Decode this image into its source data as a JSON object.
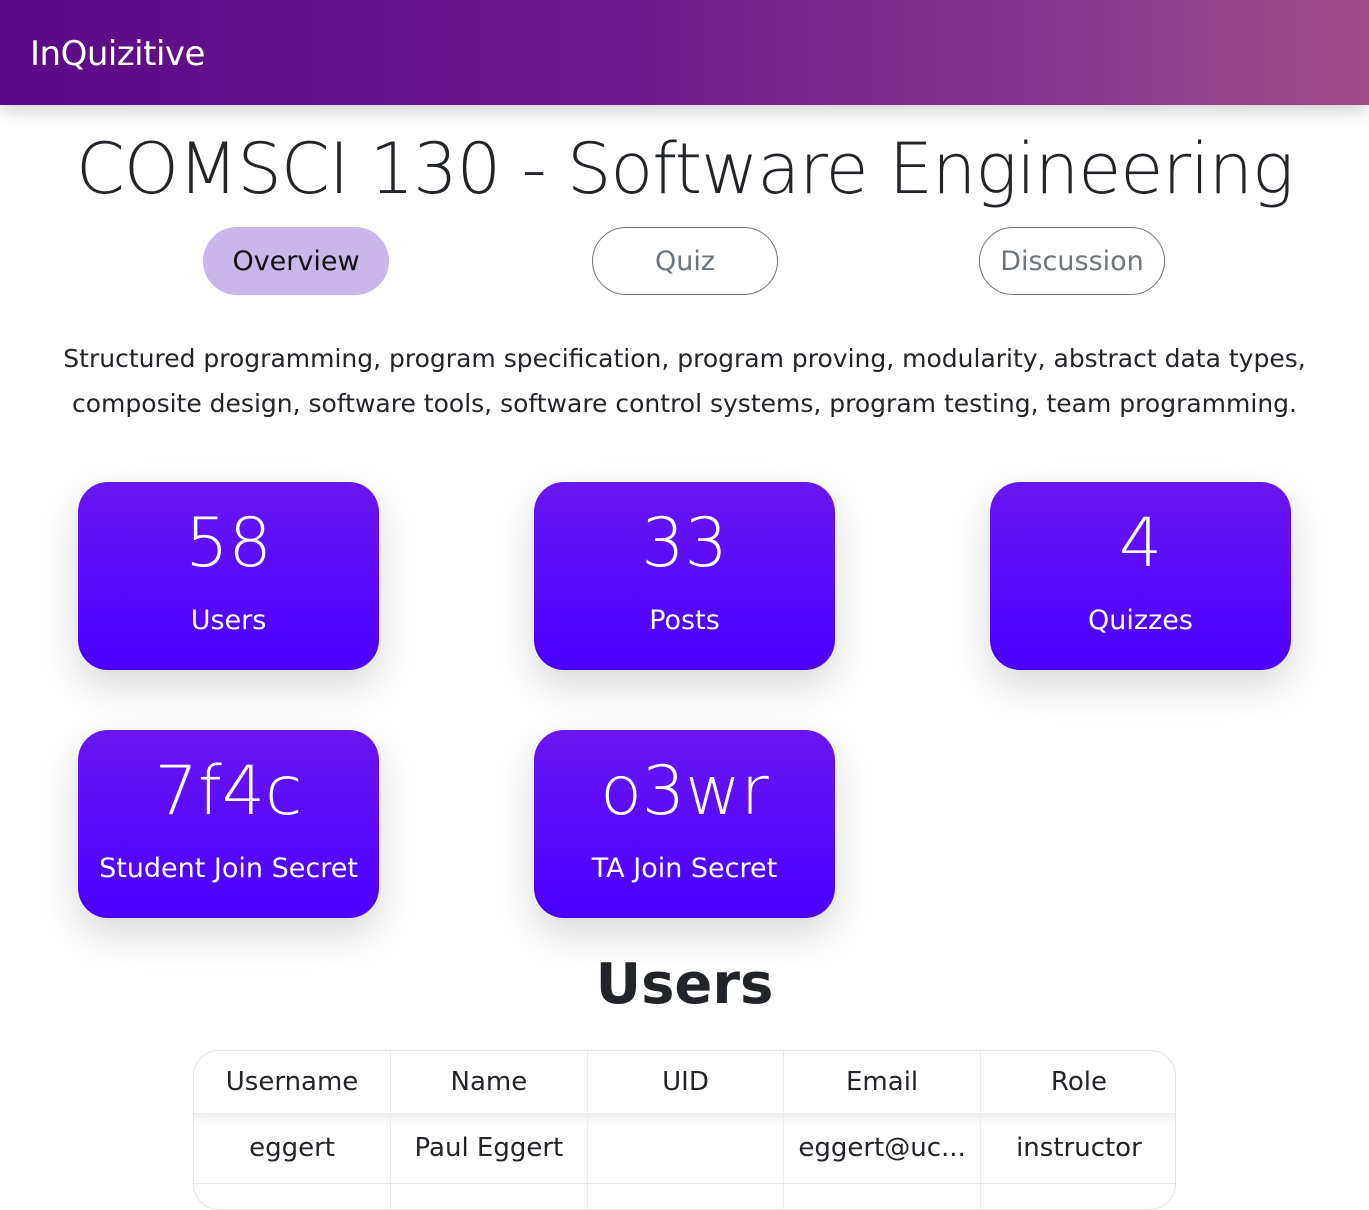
{
  "app": {
    "brand": "InQuizitive"
  },
  "course": {
    "title": "COMSCI 130 - Software Engineering",
    "description": "Structured programming, program specification, program proving, modularity, abstract data types, composite design, software tools, software control systems, program testing, team programming."
  },
  "tabs": [
    {
      "label": "Overview",
      "active": true
    },
    {
      "label": "Quiz",
      "active": false
    },
    {
      "label": "Discussion",
      "active": false
    }
  ],
  "stats": [
    {
      "value": "58",
      "label": "Users"
    },
    {
      "value": "33",
      "label": "Posts"
    },
    {
      "value": "4",
      "label": "Quizzes"
    },
    {
      "value": "7f4c",
      "label": "Student Join Secret"
    },
    {
      "value": "o3wr",
      "label": "TA Join Secret"
    }
  ],
  "users": {
    "heading": "Users",
    "columns": [
      "Username",
      "Name",
      "UID",
      "Email",
      "Role"
    ],
    "rows": [
      [
        "eggert",
        "Paul Eggert",
        "",
        "eggert@uc...",
        "instructor"
      ],
      [
        "",
        "",
        "",
        "",
        ""
      ]
    ]
  },
  "colors": {
    "navbar_start": "#5a0b86",
    "navbar_end": "#a24d8a",
    "card_top": "#6a16f2",
    "card_bottom": "#4b00ff",
    "active_tab": "#c9b7ec"
  }
}
